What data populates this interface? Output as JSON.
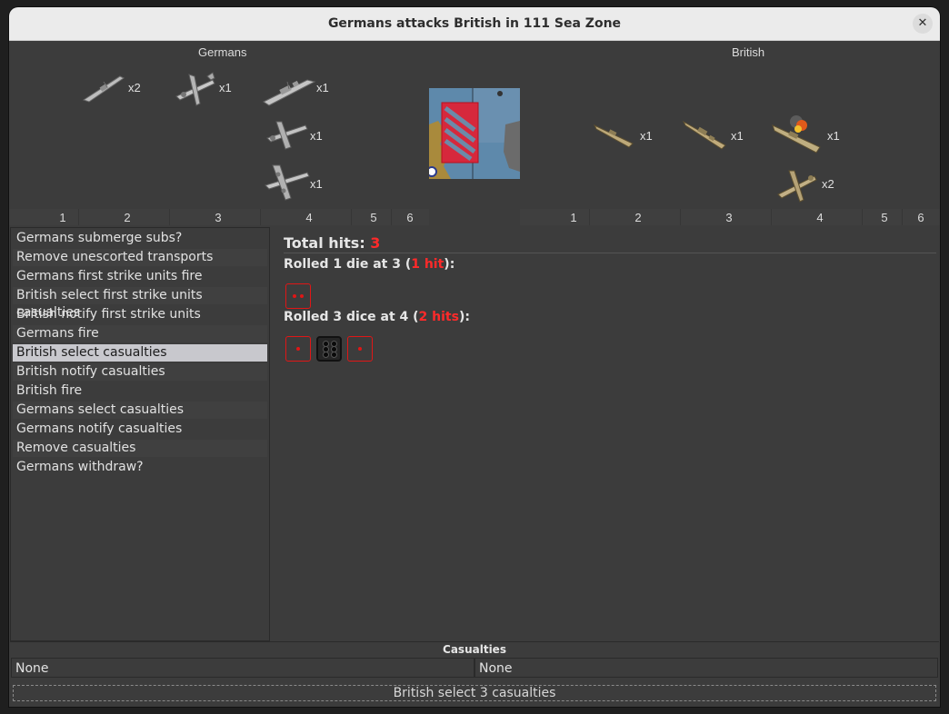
{
  "window": {
    "title": "Germans attacks British in 111 Sea Zone",
    "close_icon": "close-icon"
  },
  "attacker": {
    "label": "Germans",
    "units": [
      {
        "icon": "cruiser-icon",
        "count": "x2",
        "color": "#c0c0c0"
      },
      {
        "icon": "fighter-icon",
        "count": "x1",
        "color": "#c0c0c0"
      },
      {
        "icon": "battleship-icon",
        "count": "x1",
        "color": "#c0c0c0"
      },
      {
        "icon": "tactical-bomber-icon",
        "count": "x1",
        "color": "#c0c0c0"
      },
      {
        "icon": "bomber-icon",
        "count": "x1",
        "color": "#c0c0c0"
      }
    ],
    "columns": [
      "1",
      "2",
      "3",
      "4",
      "5",
      "6"
    ]
  },
  "defender": {
    "label": "British",
    "units": [
      {
        "icon": "destroyer-icon",
        "count": "x1",
        "color": "#b8a77a"
      },
      {
        "icon": "cruiser-icon",
        "count": "x1",
        "color": "#b8a77a"
      },
      {
        "icon": "damaged-battleship-icon",
        "count": "x1",
        "color": "#b8a77a"
      },
      {
        "icon": "fighter-icon",
        "count": "x2",
        "color": "#b8a77a"
      }
    ],
    "columns": [
      "1",
      "2",
      "3",
      "4",
      "5",
      "6"
    ]
  },
  "steps": [
    "Germans submerge subs?",
    "Remove unescorted transports",
    "Germans first strike units fire",
    "British select first strike units casualties",
    "British notify first strike units casualties",
    "Germans fire",
    "British select casualties",
    "British notify casualties",
    "British fire",
    "Germans select casualties",
    "Germans notify casualties",
    "Remove casualties",
    "Germans withdraw?"
  ],
  "selected_step": "British select casualties",
  "results": {
    "total_label": "Total hits: ",
    "total_value": "3",
    "roll1": {
      "prefix": "Rolled 1 die at 3 (",
      "hits": "1 hit",
      "suffix": "):"
    },
    "roll2": {
      "prefix": "Rolled 3 dice at 4 (",
      "hits": "2 hits",
      "suffix": "):"
    },
    "dice1": [
      2
    ],
    "dice2": [
      1,
      6,
      1
    ],
    "hit_color": "#ff2a2a"
  },
  "casualties": {
    "title": "Casualties",
    "left": "None",
    "right": "None"
  },
  "status": "British select 3 casualties"
}
